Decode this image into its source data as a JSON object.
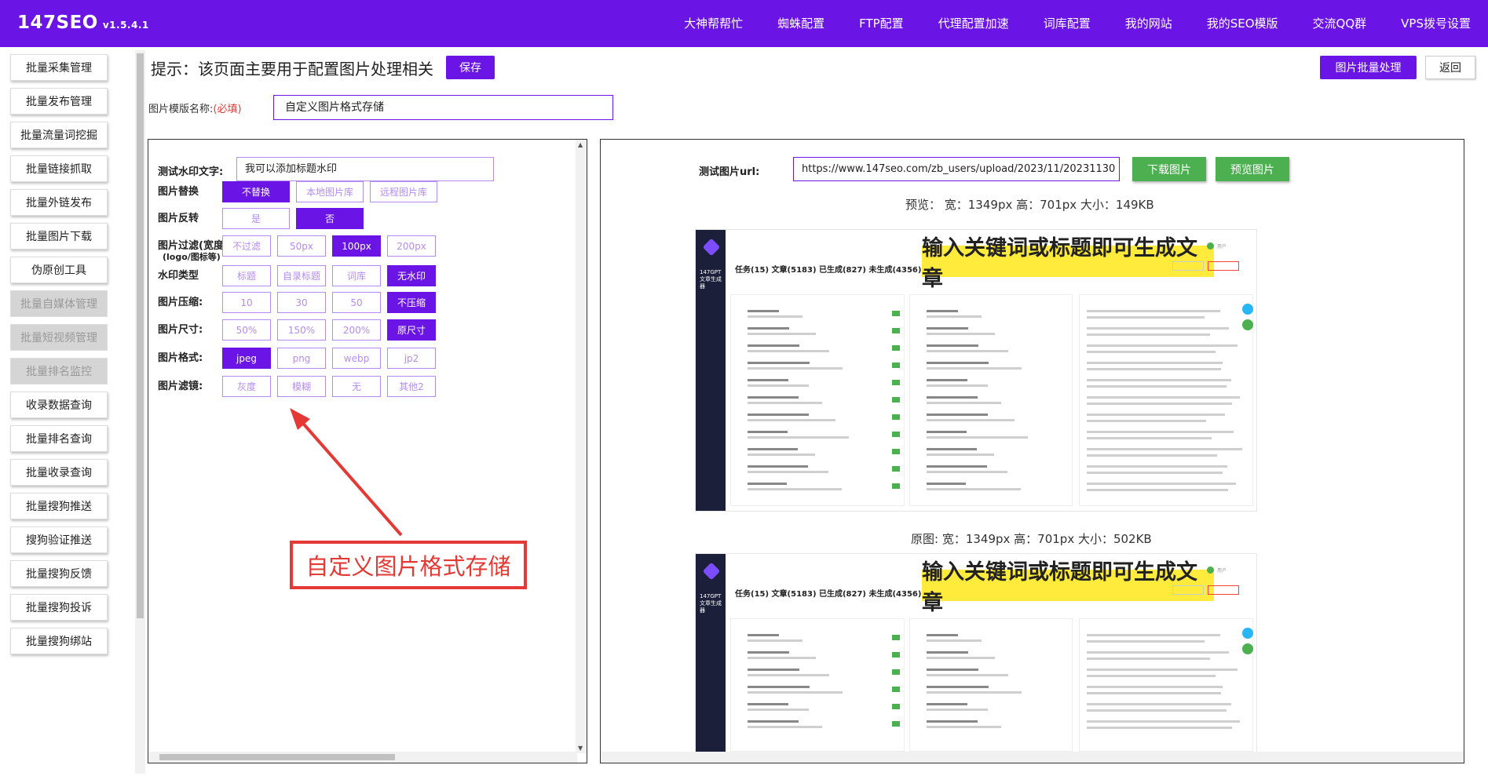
{
  "brand": {
    "name": "147SEO",
    "version": "v1.5.4.1"
  },
  "topnav": [
    "大神帮帮忙",
    "蜘蛛配置",
    "FTP配置",
    "代理配置加速",
    "词库配置",
    "我的网站",
    "我的SEO模版",
    "交流QQ群",
    "VPS拨号设置"
  ],
  "sidebar": [
    {
      "label": "批量采集管理",
      "disabled": false
    },
    {
      "label": "批量发布管理",
      "disabled": false
    },
    {
      "label": "批量流量词挖掘",
      "disabled": false
    },
    {
      "label": "批量链接抓取",
      "disabled": false
    },
    {
      "label": "批量外链发布",
      "disabled": false
    },
    {
      "label": "批量图片下载",
      "disabled": false
    },
    {
      "label": "伪原创工具",
      "disabled": false
    },
    {
      "label": "批量自媒体管理",
      "disabled": true
    },
    {
      "label": "批量短视频管理",
      "disabled": true
    },
    {
      "label": "批量排名监控",
      "disabled": true
    },
    {
      "label": "收录数据查询",
      "disabled": false
    },
    {
      "label": "批量排名查询",
      "disabled": false
    },
    {
      "label": "批量收录查询",
      "disabled": false
    },
    {
      "label": "批量搜狗推送",
      "disabled": false
    },
    {
      "label": "搜狗验证推送",
      "disabled": false
    },
    {
      "label": "批量搜狗反馈",
      "disabled": false
    },
    {
      "label": "批量搜狗投诉",
      "disabled": false
    },
    {
      "label": "批量搜狗绑站",
      "disabled": false
    }
  ],
  "header": {
    "hint": "提示：该页面主要用于配置图片处理相关",
    "save_label": "保存",
    "batch_label": "图片批量处理",
    "back_label": "返回"
  },
  "template": {
    "label": "图片模版名称:",
    "required": "(必填)",
    "value": "自定义图片格式存储"
  },
  "settings": {
    "watermark_label": "测试水印文字:",
    "watermark_value": "我可以添加标题水印",
    "rows": [
      {
        "label": "图片替换",
        "sub": "",
        "options": [
          "不替换",
          "本地图片库",
          "远程图片库"
        ],
        "active": 0
      },
      {
        "label": "图片反转",
        "sub": "",
        "options": [
          "是",
          "否"
        ],
        "active": 1
      },
      {
        "label": "图片过滤(宽度)",
        "sub": "(logo/图标等)",
        "options": [
          "不过滤",
          "50px",
          "100px",
          "200px"
        ],
        "active": 2
      },
      {
        "label": "水印类型",
        "sub": "",
        "options": [
          "标题",
          "自录标题",
          "词库",
          "无水印"
        ],
        "active": 3
      },
      {
        "label": "图片压缩:",
        "sub": "",
        "options": [
          "10",
          "30",
          "50",
          "不压缩"
        ],
        "active": 3
      },
      {
        "label": "图片尺寸:",
        "sub": "",
        "options": [
          "50%",
          "150%",
          "200%",
          "原尺寸"
        ],
        "active": 3
      },
      {
        "label": "图片格式:",
        "sub": "",
        "options": [
          "jpeg",
          "png",
          "webp",
          "jp2"
        ],
        "active": 0
      },
      {
        "label": "图片滤镜:",
        "sub": "",
        "options": [
          "灰度",
          "模糊",
          "无",
          "其他2"
        ],
        "active": -1
      }
    ],
    "callout": "自定义图片格式存储"
  },
  "preview": {
    "url_label": "测试图片url:",
    "url_value": "https://www.147seo.com/zb_users/upload/2023/11/20231130",
    "download_label": "下载图片",
    "preview_label": "预览图片",
    "preview_meta": "预览： 宽：1349px 高：701px 大小：149KB",
    "original_meta": "原图: 宽：1349px 高：701px 大小：502KB",
    "shot": {
      "banner": "输入关键词或标题即可生成文章",
      "task_line": "任务(15) 文章(5183) 已生成(827) 未生成(4356) 进行中(0)",
      "brand_small": "147GPT文章生成器",
      "user": "用户"
    }
  },
  "colors": {
    "accent": "#6a14e6",
    "green": "#4caf50",
    "red": "#e53935"
  }
}
